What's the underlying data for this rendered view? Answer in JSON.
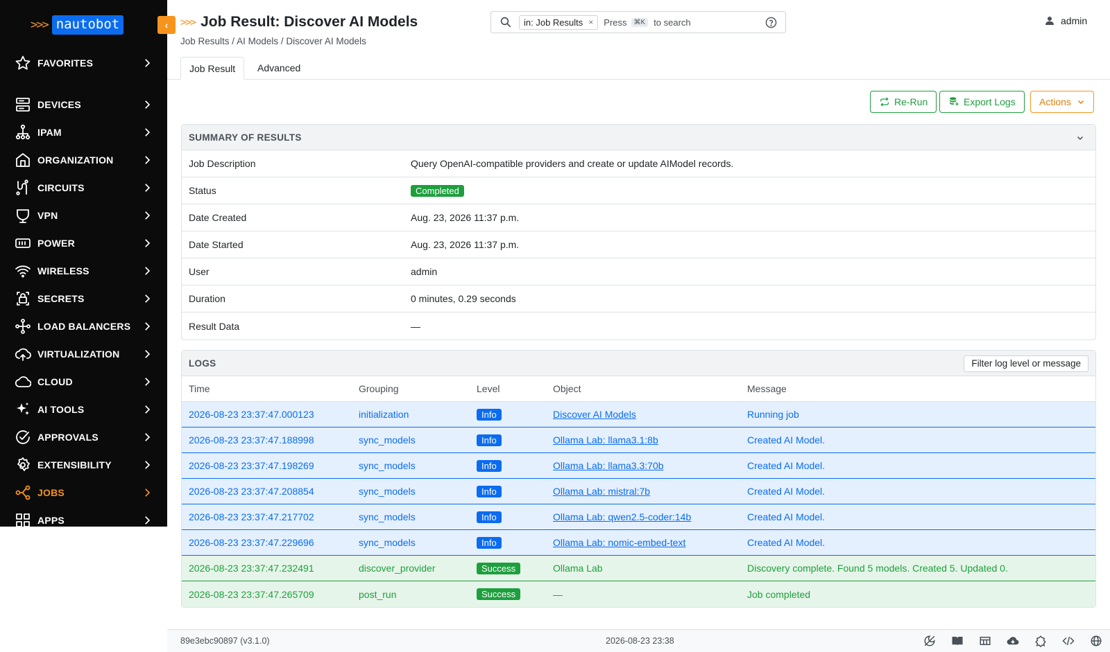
{
  "app": {
    "logo_text": "nautobot",
    "logo_arrows": ">>>"
  },
  "sidebar": {
    "items": [
      {
        "label": "FAVORITES",
        "icon": "star-icon"
      },
      {
        "label": "DEVICES",
        "icon": "server-icon"
      },
      {
        "label": "IPAM",
        "icon": "network-tree-icon"
      },
      {
        "label": "ORGANIZATION",
        "icon": "building-icon"
      },
      {
        "label": "CIRCUITS",
        "icon": "circuit-icon"
      },
      {
        "label": "VPN",
        "icon": "shield-icon"
      },
      {
        "label": "POWER",
        "icon": "power-icon"
      },
      {
        "label": "WIRELESS",
        "icon": "wifi-icon"
      },
      {
        "label": "SECRETS",
        "icon": "lock-icon"
      },
      {
        "label": "LOAD BALANCERS",
        "icon": "load-balancer-icon"
      },
      {
        "label": "VIRTUALIZATION",
        "icon": "cloud-upload-icon"
      },
      {
        "label": "CLOUD",
        "icon": "cloud-icon"
      },
      {
        "label": "AI TOOLS",
        "icon": "sparkle-icon"
      },
      {
        "label": "APPROVALS",
        "icon": "check-circle-icon"
      },
      {
        "label": "EXTENSIBILITY",
        "icon": "gear-icon"
      },
      {
        "label": "JOBS",
        "icon": "jobs-icon"
      },
      {
        "label": "APPS",
        "icon": "apps-grid-icon"
      }
    ],
    "active": "JOBS"
  },
  "header": {
    "title_arrows": ">>>",
    "title": "Job Result: Discover AI Models",
    "breadcrumb": [
      "Job Results",
      "AI Models",
      "Discover AI Models"
    ],
    "breadcrumb_sep": " / ",
    "search": {
      "chip": "in: Job Results",
      "chip_close": "×",
      "press": "Press",
      "kbd": "⌘K",
      "hint": "to search"
    },
    "user": "admin"
  },
  "tabs": [
    {
      "label": "Job Result",
      "active": true
    },
    {
      "label": "Advanced",
      "active": false
    }
  ],
  "toolbar": {
    "rerun": "Re-Run",
    "export": "Export Logs",
    "actions": "Actions"
  },
  "summary": {
    "heading": "SUMMARY OF RESULTS",
    "rows": [
      {
        "key": "Job Description",
        "value": "Query OpenAI-compatible providers and create or update AIModel records."
      },
      {
        "key": "Status",
        "value": "Completed"
      },
      {
        "key": "Date Created",
        "value": "Aug. 23, 2026 11:37 p.m."
      },
      {
        "key": "Date Started",
        "value": "Aug. 23, 2026 11:37 p.m."
      },
      {
        "key": "User",
        "value": "admin"
      },
      {
        "key": "Duration",
        "value": "0 minutes, 0.29 seconds"
      },
      {
        "key": "Result Data",
        "value": "—"
      }
    ]
  },
  "logs": {
    "heading": "LOGS",
    "filter_placeholder": "Filter log level or message",
    "columns": [
      "Time",
      "Grouping",
      "Level",
      "Object",
      "Message"
    ],
    "rows": [
      {
        "time": "2026-08-23 23:37:47.000123",
        "grouping": "initialization",
        "level": "Info",
        "object": "Discover AI Models",
        "object_link": true,
        "message": "Running job",
        "kind": "info"
      },
      {
        "time": "2026-08-23 23:37:47.188998",
        "grouping": "sync_models",
        "level": "Info",
        "object": "Ollama Lab: llama3.1:8b",
        "object_link": true,
        "message": "Created AI Model.",
        "kind": "info"
      },
      {
        "time": "2026-08-23 23:37:47.198269",
        "grouping": "sync_models",
        "level": "Info",
        "object": "Ollama Lab: llama3.3:70b",
        "object_link": true,
        "message": "Created AI Model.",
        "kind": "info"
      },
      {
        "time": "2026-08-23 23:37:47.208854",
        "grouping": "sync_models",
        "level": "Info",
        "object": "Ollama Lab: mistral:7b",
        "object_link": true,
        "message": "Created AI Model.",
        "kind": "info"
      },
      {
        "time": "2026-08-23 23:37:47.217702",
        "grouping": "sync_models",
        "level": "Info",
        "object": "Ollama Lab: qwen2.5-coder:14b",
        "object_link": true,
        "message": "Created AI Model.",
        "kind": "info"
      },
      {
        "time": "2026-08-23 23:37:47.229696",
        "grouping": "sync_models",
        "level": "Info",
        "object": "Ollama Lab: nomic-embed-text",
        "object_link": true,
        "message": "Created AI Model.",
        "kind": "info"
      },
      {
        "time": "2026-08-23 23:37:47.232491",
        "grouping": "discover_provider",
        "level": "Success",
        "object": "Ollama Lab",
        "object_link": false,
        "message": "Discovery complete. Found 5 models. Created 5. Updated 0.",
        "kind": "success"
      },
      {
        "time": "2026-08-23 23:37:47.265709",
        "grouping": "post_run",
        "level": "Success",
        "object": "—",
        "object_link": false,
        "message": "Job completed",
        "kind": "success"
      }
    ]
  },
  "footer": {
    "version": "89e3ebc90897 (v3.1.0)",
    "timestamp": "2026-08-23 23:38"
  },
  "colors": {
    "accent": "#f7941d",
    "blue": "#0b6cf0",
    "green": "#1e9f3e",
    "sidebar_bg": "#0b0b0b"
  }
}
